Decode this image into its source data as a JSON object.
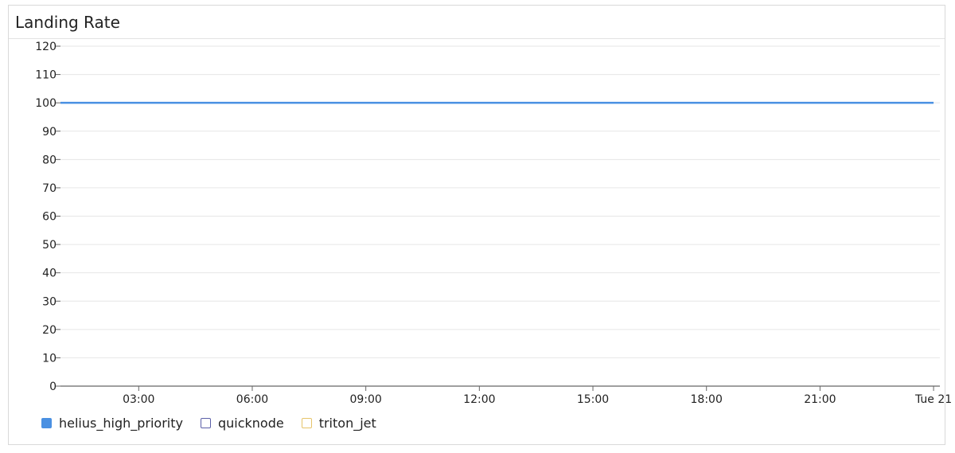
{
  "panel": {
    "title": "Landing Rate"
  },
  "colors": {
    "helius_high_priority": "#4a90e2",
    "quicknode": "#5b5fa8",
    "triton_jet": "#e6c46a",
    "grid": "#e6e6e6",
    "axis": "#666666"
  },
  "chart_data": {
    "type": "line",
    "title": "Landing Rate",
    "xlabel": "",
    "ylabel": "",
    "ylim": [
      0,
      120
    ],
    "yticks": [
      0,
      10,
      20,
      30,
      40,
      50,
      60,
      70,
      80,
      90,
      100,
      110,
      120
    ],
    "xticks": [
      "03:00",
      "06:00",
      "09:00",
      "12:00",
      "15:00",
      "18:00",
      "21:00",
      "Tue 21"
    ],
    "grid": true,
    "legend_position": "bottom-left",
    "series": [
      {
        "name": "helius_high_priority",
        "x": [
          "00:56",
          "24:00"
        ],
        "values": [
          100,
          100
        ],
        "legend_filled": true
      },
      {
        "name": "quicknode",
        "x": [],
        "values": [],
        "legend_filled": false
      },
      {
        "name": "triton_jet",
        "x": [],
        "values": [],
        "legend_filled": false
      }
    ]
  }
}
